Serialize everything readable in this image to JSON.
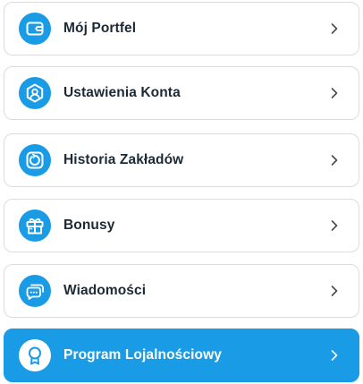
{
  "menu": {
    "items": [
      {
        "label": "Mój Portfel",
        "icon": "wallet-icon"
      },
      {
        "label": "Ustawienia Konta",
        "icon": "user-settings-icon"
      },
      {
        "label": "Historia Zakładów",
        "icon": "history-icon"
      },
      {
        "label": "Bonusy",
        "icon": "gift-icon"
      },
      {
        "label": "Wiadomości",
        "icon": "messages-icon"
      },
      {
        "label": "Program Lojalnościowy",
        "icon": "loyalty-badge-icon",
        "active": true
      }
    ]
  },
  "colors": {
    "accent": "#1a9be6",
    "border": "#dcdcdc",
    "text": "#1c2a36",
    "active_text": "#ffffff"
  }
}
